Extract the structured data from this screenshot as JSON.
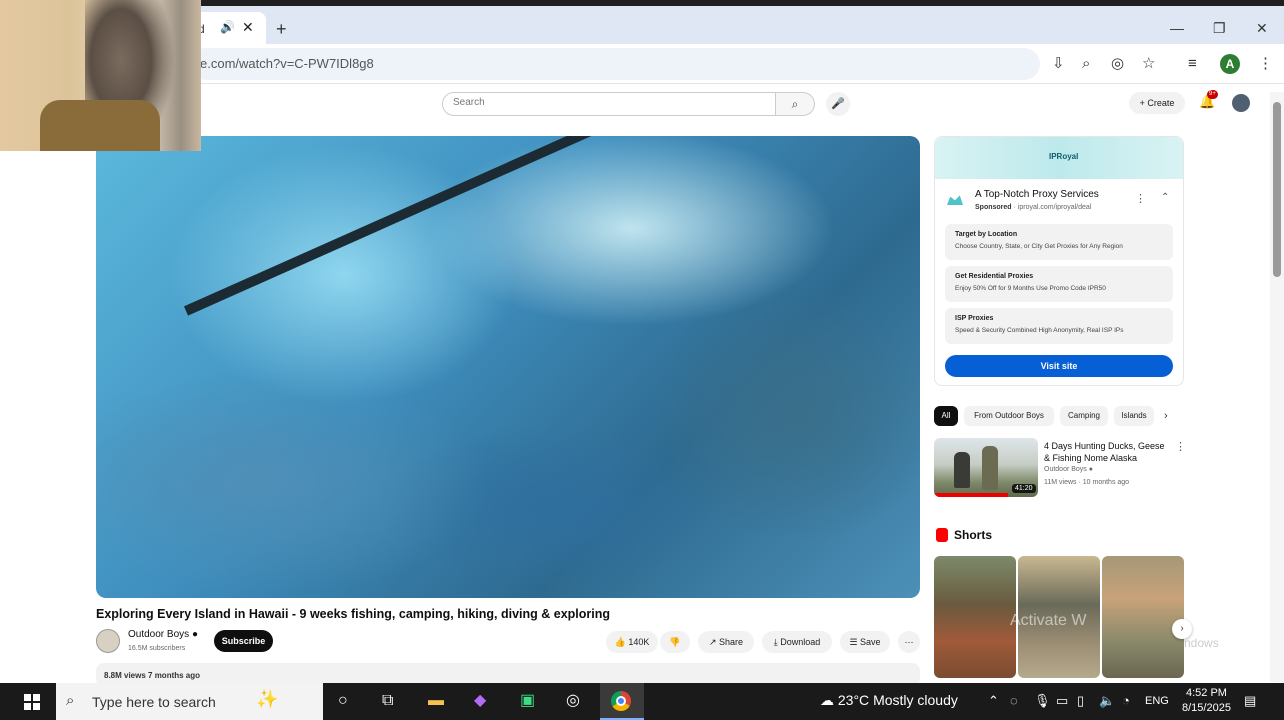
{
  "browser": {
    "tab_title": "d",
    "tab_audio_icon": "speaker-icon",
    "url": "e.com/watch?v=C-PW7IDl8g8"
  },
  "youtube": {
    "search_placeholder": "Search",
    "create_label": "Create",
    "notifications_badge": "9+"
  },
  "video": {
    "title": "Exploring Every Island in Hawaii - 9 weeks fishing, camping, hiking, diving & exploring",
    "channel_name": "Outdoor Boys",
    "subscribers": "16.5M subscribers",
    "subscribe_label": "Subscribe",
    "likes": "140K",
    "share_label": "Share",
    "download_label": "Download",
    "save_label": "Save",
    "views_meta": "8.8M views  7 months ago"
  },
  "ad": {
    "brand": "IPRoyal",
    "title": "A Top-Notch Proxy Services",
    "sponsored": "Sponsored",
    "domain": " · iproyal.com/iproyal/deal",
    "rows": [
      {
        "heading": "Target by Location",
        "sub": "Choose Country, State, or City Get Proxies for Any Region"
      },
      {
        "heading": "Get Residential Proxies",
        "sub": "Enjoy 50% Off for 9 Months Use Promo Code IPR50"
      },
      {
        "heading": "ISP Proxies",
        "sub": "Speed & Security Combined High Anonymity, Real ISP IPs"
      }
    ],
    "visit_label": "Visit site"
  },
  "chips": [
    "All",
    "From Outdoor Boys",
    "Camping",
    "Islands"
  ],
  "recommendation": {
    "title": "4 Days Hunting Ducks, Geese & Fishing Nome Alaska",
    "channel": "Outdoor Boys",
    "meta": "11M views · 10 months ago",
    "duration": "41:20"
  },
  "shorts": {
    "label": "Shorts",
    "watermark": "Activate W",
    "watermark2": "ndows"
  },
  "taskbar": {
    "search_placeholder": "Type here to search",
    "temperature": "23°C",
    "weather": "Mostly cloudy",
    "language": "ENG",
    "time": "4:52 PM",
    "date": "8/15/2025"
  },
  "colors": {
    "accent": "#065fd4",
    "subscribe": "#0f0f0f",
    "badge": "#cc0000"
  }
}
